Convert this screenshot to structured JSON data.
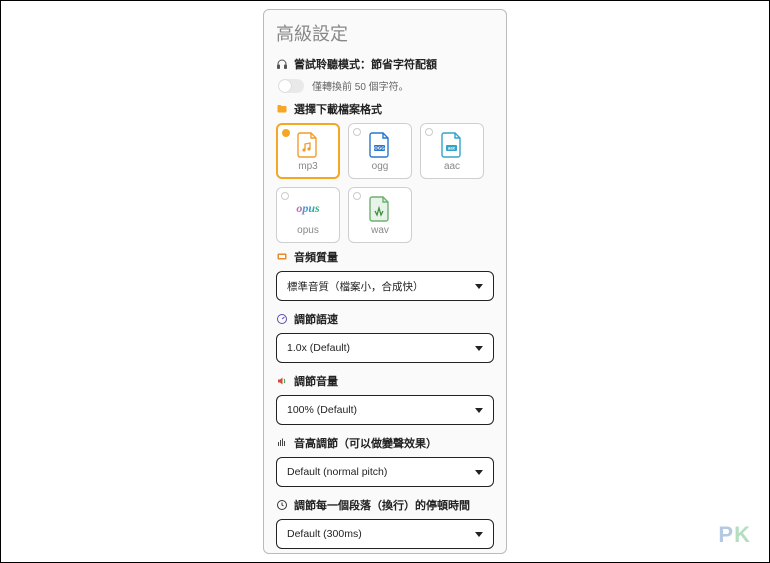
{
  "panel": {
    "title": "高級設定",
    "preview": {
      "label": "嘗試聆聽模式：節省字符配額",
      "toggle_on": false,
      "sub_text": "僅轉換前 50 個字符。"
    },
    "format_section": {
      "label": "選擇下載檔案格式",
      "options": [
        {
          "id": "mp3",
          "label": "mp3",
          "selected": true
        },
        {
          "id": "ogg",
          "label": "ogg",
          "selected": false
        },
        {
          "id": "aac",
          "label": "aac",
          "selected": false
        },
        {
          "id": "opus",
          "label": "opus",
          "selected": false
        },
        {
          "id": "wav",
          "label": "wav",
          "selected": false
        }
      ]
    },
    "quality": {
      "label": "音頻質量",
      "value": "標準音質（檔案小，合成快）"
    },
    "speed": {
      "label": "調節語速",
      "value": "1.0x (Default)"
    },
    "volume": {
      "label": "調節音量",
      "value": "100% (Default)"
    },
    "pitch": {
      "label": "音高調節（可以做變聲效果）",
      "value": "Default (normal pitch)"
    },
    "pause": {
      "label": "調節每一個段落（換行）的停頓時間",
      "value": "Default (300ms)"
    }
  },
  "watermark": {
    "p": "P",
    "k": "K"
  }
}
